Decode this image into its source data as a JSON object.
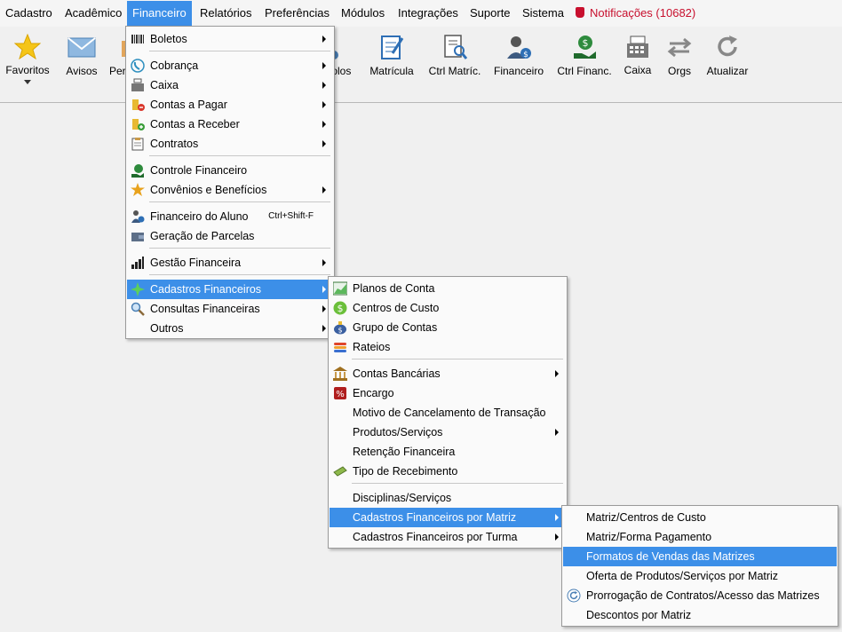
{
  "menubar": {
    "items": [
      {
        "label": "Cadastro"
      },
      {
        "label": "Acadêmico"
      },
      {
        "label": "Financeiro"
      },
      {
        "label": "Relatórios"
      },
      {
        "label": "Preferências"
      },
      {
        "label": "Módulos"
      },
      {
        "label": "Integrações"
      },
      {
        "label": "Suporte"
      },
      {
        "label": "Sistema"
      }
    ],
    "notifications": "Notificações (10682)"
  },
  "toolbar": {
    "favoritos": "Favoritos",
    "avisos": "Avisos",
    "per": "Per",
    "tolos": "tolos",
    "matricula": "Matrícula",
    "ctrl_matric": "Ctrl Matríc.",
    "financeiro": "Financeiro",
    "ctrl_financ": "Ctrl Financ.",
    "caixa": "Caixa",
    "orgs": "Orgs",
    "atualizar": "Atualizar"
  },
  "menu1": {
    "boletos": "Boletos",
    "cobranca": "Cobrança",
    "caixa": "Caixa",
    "contas_pagar": "Contas a Pagar",
    "contas_receber": "Contas a Receber",
    "contratos": "Contratos",
    "controle_financeiro": "Controle Financeiro",
    "convenios": "Convênios e Benefícios",
    "financeiro_aluno": "Financeiro do Aluno",
    "financeiro_aluno_shortcut": "Ctrl+Shift-F",
    "geracao_parcelas": "Geração de Parcelas",
    "gestao_financeira": "Gestão Financeira",
    "cadastros_financeiros": "Cadastros Financeiros",
    "consultas_financeiras": "Consultas Financeiras",
    "outros": "Outros"
  },
  "menu2": {
    "planos_conta": "Planos de Conta",
    "centros_custo": "Centros de Custo",
    "grupo_contas": "Grupo de Contas",
    "rateios": "Rateios",
    "contas_bancarias": "Contas Bancárias",
    "encargo": "Encargo",
    "motivo_cancelamento": "Motivo de Cancelamento de Transação",
    "produtos_servicos": "Produtos/Serviços",
    "retencao_financeira": "Retenção Financeira",
    "tipo_recebimento": "Tipo de Recebimento",
    "disciplinas_servicos": "Disciplinas/Serviços",
    "cad_fin_matriz": "Cadastros Financeiros por Matriz",
    "cad_fin_turma": "Cadastros Financeiros por Turma"
  },
  "menu3": {
    "matriz_centros": "Matriz/Centros de Custo",
    "matriz_forma": "Matriz/Forma Pagamento",
    "formatos_vendas": "Formatos de Vendas das Matrizes",
    "oferta_produtos": "Oferta de Produtos/Serviços por Matriz",
    "prorrogacao": "Prorrogação de Contratos/Acesso das Matrizes",
    "descontos": "Descontos por Matriz"
  },
  "colors": {
    "highlight": "#3c8fe8",
    "notification": "#c8102e"
  }
}
